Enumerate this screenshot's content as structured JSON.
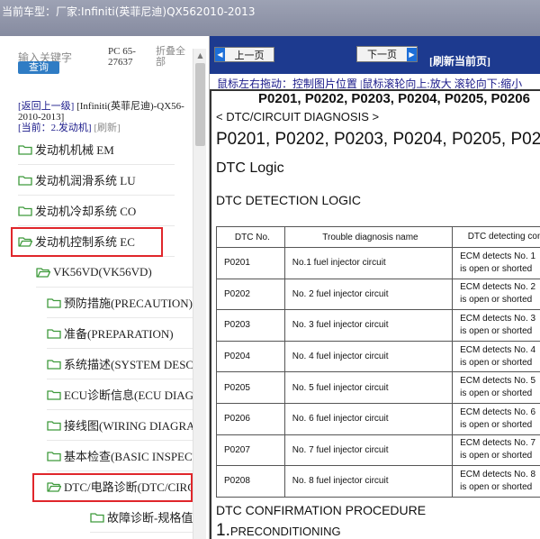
{
  "header": {
    "vehicle_label": "当前车型：",
    "vehicle_value": "厂家:Infiniti(英菲尼迪)QX562010-2013"
  },
  "sidebar": {
    "search_label": "输入关键字",
    "code": "PC 65-27637",
    "collapse_all": "折叠全部",
    "query_button": "查询",
    "crumb": {
      "back": "[返回上一级]",
      "path": "[Infiniti(英菲尼迪)-QX56-2010-2013]",
      "current_label": "[当前：",
      "current_value": "2.发动机]",
      "refresh": "[刷新]"
    },
    "items": [
      {
        "label": "发动机机械 EM"
      },
      {
        "label": "发动机润滑系统 LU"
      },
      {
        "label": "发动机冷却系统 CO"
      },
      {
        "label": "发动机控制系统 EC"
      },
      {
        "label": "VK56VD(VK56VD)"
      },
      {
        "label": "预防措施(PRECAUTION)"
      },
      {
        "label": "准备(PREPARATION)"
      },
      {
        "label": "系统描述(SYSTEM DESCRIPTION)"
      },
      {
        "label": "ECU诊断信息(ECU DIAGNOSIS)"
      },
      {
        "label": "接线图(WIRING DIAGRAM)"
      },
      {
        "label": "基本检查(BASIC INSPECTION)"
      },
      {
        "label": "DTC/电路诊断(DTC/CIRCUIT DIAGNOSIS)"
      },
      {
        "label": "故障诊断-规格值"
      }
    ]
  },
  "toolbar": {
    "prev_label": "上一页",
    "next_label": "下一页",
    "refresh_label": "[刷新当前页]",
    "hint": "鼠标左右拖动：控制图片位置 |鼠标滚轮向上:放大 滚轮向下:缩小"
  },
  "document": {
    "heading": "P0201, P0202, P0203, P0204, P0205, P0206",
    "section": "< DTC/CIRCUIT DIAGNOSIS >",
    "title": "P0201, P0202, P0203, P0204, P0205, P0206",
    "dtc_logic": "DTC Logic",
    "detection_logic": "DTC DETECTION LOGIC",
    "table": {
      "headers": [
        "DTC No.",
        "Trouble diagnosis name",
        "DTC detecting condition"
      ],
      "rows": [
        {
          "no": "P0201",
          "name": "No.1 fuel injector circuit",
          "cond1": "ECM detects No. 1",
          "cond2": "is open or shorted"
        },
        {
          "no": "P0202",
          "name": "No. 2 fuel injector circuit",
          "cond1": "ECM detects No. 2",
          "cond2": "is open or shorted"
        },
        {
          "no": "P0203",
          "name": "No. 3 fuel injector circuit",
          "cond1": "ECM detects No. 3",
          "cond2": "is open or shorted"
        },
        {
          "no": "P0204",
          "name": "No. 4 fuel injector circuit",
          "cond1": "ECM detects No. 4",
          "cond2": "is open or shorted"
        },
        {
          "no": "P0205",
          "name": "No. 5 fuel injector circuit",
          "cond1": "ECM detects No. 5",
          "cond2": "is open or shorted"
        },
        {
          "no": "P0206",
          "name": "No. 6 fuel injector circuit",
          "cond1": "ECM detects No. 6",
          "cond2": "is open or shorted"
        },
        {
          "no": "P0207",
          "name": "No. 7 fuel injector circuit",
          "cond1": "ECM detects No. 7",
          "cond2": "is open or shorted"
        },
        {
          "no": "P0208",
          "name": "No. 8 fuel injector circuit",
          "cond1": "ECM detects No. 8",
          "cond2": "is open or shorted"
        }
      ]
    },
    "confirm_title": "DTC CONFIRMATION PROCEDURE",
    "precond_num": "1.",
    "precond_text": "PRECONDITIONING"
  },
  "colors": {
    "highlight": "#e0262b",
    "toolbar_bg": "#1d3a8f",
    "button_blue": "#2f7cc4",
    "folder_green": "#3f9a3c"
  }
}
